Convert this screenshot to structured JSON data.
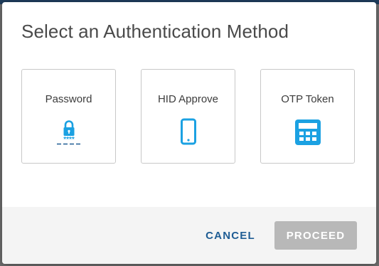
{
  "dialog": {
    "title": "Select an Authentication Method"
  },
  "methods": [
    {
      "label": "Password",
      "icon": "lock-password-icon"
    },
    {
      "label": "HID Approve",
      "icon": "mobile-phone-icon"
    },
    {
      "label": "OTP Token",
      "icon": "otp-token-icon"
    }
  ],
  "footer": {
    "cancel_label": "CANCEL",
    "proceed_label": "PROCEED"
  },
  "colors": {
    "accent": "#1f5d94",
    "icon": "#1ba1e2",
    "disabled_button": "#b8b8b8"
  }
}
